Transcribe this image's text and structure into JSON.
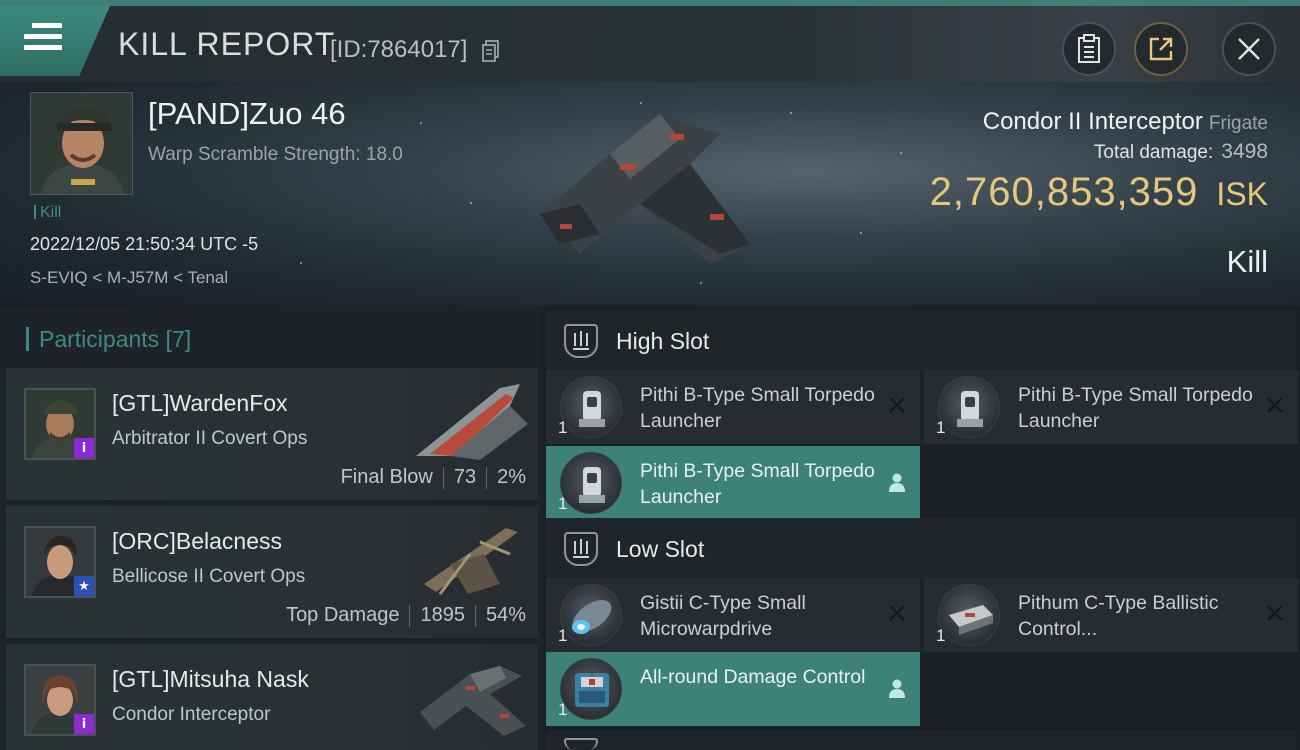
{
  "header": {
    "title": "KILL REPORT",
    "report_id": "[ID:7864017]",
    "icons": [
      "menu-icon",
      "copy-icon",
      "clipboard-icon",
      "share-icon",
      "close-icon"
    ]
  },
  "victim": {
    "name": "[PAND]Zuo 46",
    "warp": "Warp Scramble Strength: 18.0",
    "kill_count": "Kill",
    "datetime": "2022/12/05 21:50:34 UTC -5",
    "route": "S-EVIQ < M-J57M < Tenal",
    "ship_name": "Condor II Interceptor",
    "ship_class": "Frigate",
    "total_damage_label": "Total damage:",
    "total_damage": "3498",
    "isk_value": "2,760,853,359",
    "isk_unit": "ISK",
    "result": "Kill"
  },
  "participants": {
    "heading": "Participants [7]",
    "rows": [
      {
        "name": "[GTL]WardenFox",
        "ship": "Arbitrator II Covert Ops",
        "role": "Final Blow",
        "damage": "73",
        "percent": "2%",
        "badge": "i",
        "badge_color": "#8a2bd4"
      },
      {
        "name": "[ORC]Belacness",
        "ship": "Bellicose II Covert Ops",
        "role": "Top Damage",
        "damage": "1895",
        "percent": "54%",
        "badge": "★",
        "badge_color": "#2d4fb8"
      },
      {
        "name": "[GTL]Mitsuha Nask",
        "ship": "Condor Interceptor",
        "role": "",
        "damage": "",
        "percent": "",
        "badge": "i",
        "badge_color": "#8a2bd4"
      }
    ]
  },
  "fitting": {
    "high_slot": {
      "title": "High Slot",
      "modules": [
        {
          "name": "Pithi B-Type Small Torpedo Launcher",
          "qty": "1",
          "active": false
        },
        {
          "name": "Pithi B-Type Small Torpedo Launcher",
          "qty": "1",
          "active": false
        },
        {
          "name": "Pithi B-Type Small Torpedo Launcher",
          "qty": "1",
          "active": true
        }
      ]
    },
    "low_slot": {
      "title": "Low Slot",
      "modules": [
        {
          "name": "Gistii C-Type Small Microwarpdrive",
          "qty": "1",
          "active": false
        },
        {
          "name": "Pithum C-Type Ballistic Control...",
          "qty": "1",
          "active": false
        },
        {
          "name": "All-round Damage Control",
          "qty": "1",
          "active": true
        }
      ]
    }
  },
  "colors": {
    "accent": "#3c8a7f",
    "isk": "#e6c77c",
    "active_module": "#3d8276"
  }
}
